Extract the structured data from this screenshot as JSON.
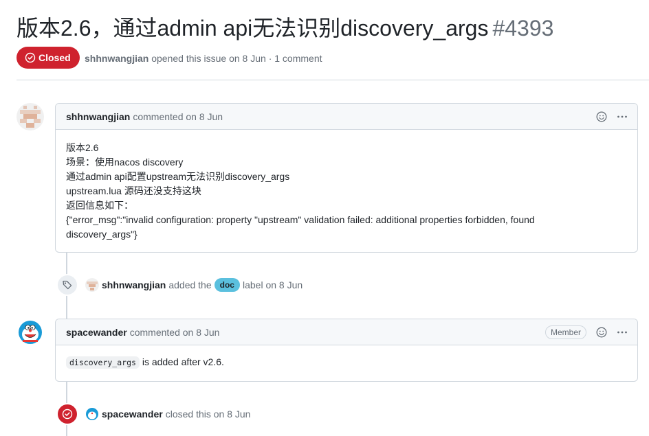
{
  "issue": {
    "title": "版本2.6，通过admin api无法识别discovery_args",
    "number": "#4393",
    "status": "Closed",
    "status_color": "#cf222e",
    "author": "shhnwangjian",
    "opened_text": "opened this issue on 8 Jun · 1 comment"
  },
  "comments": [
    {
      "author": "shhnwangjian",
      "action": "commented on 8 Jun",
      "body_lines": [
        "版本2.6",
        "场景：使用nacos discovery",
        "通过admin api配置upstream无法识别discovery_args",
        "upstream.lua 源码还没支持这块",
        "返回信息如下：",
        "{\"error_msg\":\"invalid configuration: property \"upstream\" validation failed: additional properties forbidden, found",
        "discovery_args\"}"
      ]
    },
    {
      "author": "spacewander",
      "action": "commented on 8 Jun",
      "badge": "Member",
      "body_code": "discovery_args",
      "body_text": " is added after v2.6."
    }
  ],
  "events": [
    {
      "icon": "tag-icon",
      "actor": "shhnwangjian",
      "pre_text": "added the",
      "label": "doc",
      "label_color": "#5bc0de",
      "post_text": "label on 8 Jun"
    },
    {
      "icon": "closed-circle-icon",
      "actor": "spacewander",
      "text": "closed this on 8 Jun"
    }
  ]
}
